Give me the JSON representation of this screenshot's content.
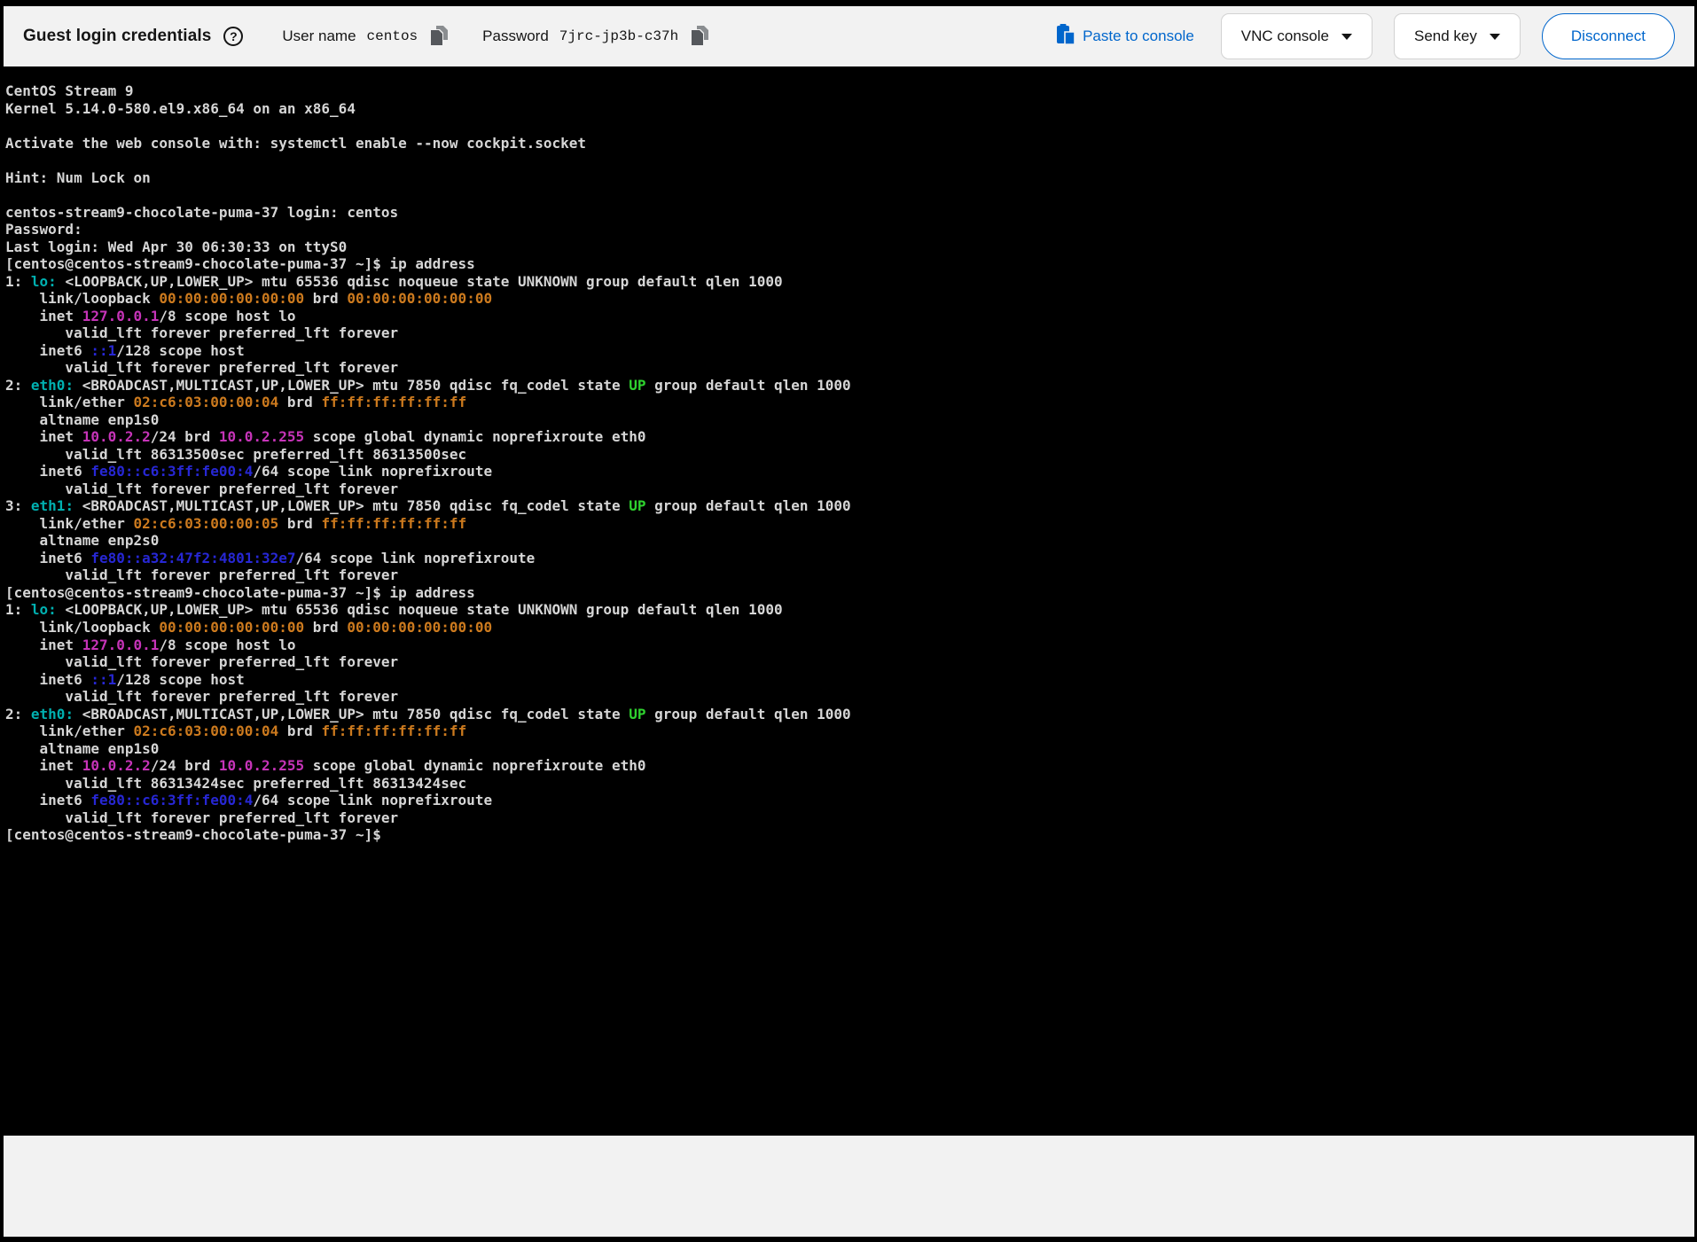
{
  "header": {
    "title": "Guest login credentials",
    "username_label": "User name",
    "username_value": "centos",
    "password_label": "Password",
    "password_value": "7jrc-jp3b-c37h",
    "paste_button_label": "Paste to console",
    "vnc_console_dropdown_label": "VNC console",
    "send_key_dropdown_label": "Send key",
    "disconnect_button_label": "Disconnect",
    "help_icon": "question-circle-icon",
    "copy_icon": "copy-icon",
    "paste_icon": "paste-icon",
    "accent_color": "#0066cc",
    "background_color": "#f2f2f2",
    "text_color": "#151515"
  },
  "terminal": {
    "background_color": "#000000",
    "palette": {
      "default": "#d6d6d6",
      "cyan": "#00b0b0",
      "orange": "#cc7a1e",
      "magenta": "#c634b8",
      "blue": "#2727d4",
      "green": "#2fd22f"
    },
    "lines": [
      [
        {
          "t": "CentOS Stream 9"
        }
      ],
      [
        {
          "t": "Kernel 5.14.0-580.el9.x86_64 on an x86_64"
        }
      ],
      [],
      [
        {
          "t": "Activate the web console with: systemctl enable --now cockpit.socket"
        }
      ],
      [],
      [
        {
          "t": "Hint: Num Lock on"
        }
      ],
      [],
      [
        {
          "t": "centos-stream9-chocolate-puma-37 login: centos"
        }
      ],
      [
        {
          "t": "Password:"
        }
      ],
      [
        {
          "t": "Last login: Wed Apr 30 06:30:33 on ttyS0"
        }
      ],
      [
        {
          "t": "[centos@centos-stream9-chocolate-puma-37 ~]$ ip address"
        }
      ],
      [
        {
          "t": "1: "
        },
        {
          "t": "lo:",
          "c": "cyan"
        },
        {
          "t": " <LOOPBACK,UP,LOWER_UP> mtu 65536 qdisc noqueue state UNKNOWN group default qlen 1000"
        }
      ],
      [
        {
          "t": "    link/loopback "
        },
        {
          "t": "00:00:00:00:00:00",
          "c": "orange"
        },
        {
          "t": " brd "
        },
        {
          "t": "00:00:00:00:00:00",
          "c": "orange"
        }
      ],
      [
        {
          "t": "    inet "
        },
        {
          "t": "127.0.0.1",
          "c": "magenta"
        },
        {
          "t": "/8 scope host lo"
        }
      ],
      [
        {
          "t": "       valid_lft forever preferred_lft forever"
        }
      ],
      [
        {
          "t": "    inet6 "
        },
        {
          "t": "::1",
          "c": "blue"
        },
        {
          "t": "/128 scope host"
        }
      ],
      [
        {
          "t": "       valid_lft forever preferred_lft forever"
        }
      ],
      [
        {
          "t": "2: "
        },
        {
          "t": "eth0:",
          "c": "cyan"
        },
        {
          "t": " <BROADCAST,MULTICAST,UP,LOWER_UP> mtu 7850 qdisc fq_codel state "
        },
        {
          "t": "UP",
          "c": "green"
        },
        {
          "t": " group default qlen 1000"
        }
      ],
      [
        {
          "t": "    link/ether "
        },
        {
          "t": "02:c6:03:00:00:04",
          "c": "orange"
        },
        {
          "t": " brd "
        },
        {
          "t": "ff:ff:ff:ff:ff:ff",
          "c": "orange"
        }
      ],
      [
        {
          "t": "    altname enp1s0"
        }
      ],
      [
        {
          "t": "    inet "
        },
        {
          "t": "10.0.2.2",
          "c": "magenta"
        },
        {
          "t": "/24 brd "
        },
        {
          "t": "10.0.2.255",
          "c": "magenta"
        },
        {
          "t": " scope global dynamic noprefixroute eth0"
        }
      ],
      [
        {
          "t": "       valid_lft 86313500sec preferred_lft 86313500sec"
        }
      ],
      [
        {
          "t": "    inet6 "
        },
        {
          "t": "fe80::c6:3ff:fe00:4",
          "c": "blue"
        },
        {
          "t": "/64 scope link noprefixroute"
        }
      ],
      [
        {
          "t": "       valid_lft forever preferred_lft forever"
        }
      ],
      [
        {
          "t": "3: "
        },
        {
          "t": "eth1:",
          "c": "cyan"
        },
        {
          "t": " <BROADCAST,MULTICAST,UP,LOWER_UP> mtu 7850 qdisc fq_codel state "
        },
        {
          "t": "UP",
          "c": "green"
        },
        {
          "t": " group default qlen 1000"
        }
      ],
      [
        {
          "t": "    link/ether "
        },
        {
          "t": "02:c6:03:00:00:05",
          "c": "orange"
        },
        {
          "t": " brd "
        },
        {
          "t": "ff:ff:ff:ff:ff:ff",
          "c": "orange"
        }
      ],
      [
        {
          "t": "    altname enp2s0"
        }
      ],
      [
        {
          "t": "    inet6 "
        },
        {
          "t": "fe80::a32:47f2:4801:32e7",
          "c": "blue"
        },
        {
          "t": "/64 scope link noprefixroute"
        }
      ],
      [
        {
          "t": "       valid_lft forever preferred_lft forever"
        }
      ],
      [
        {
          "t": "[centos@centos-stream9-chocolate-puma-37 ~]$ ip address"
        }
      ],
      [
        {
          "t": "1: "
        },
        {
          "t": "lo:",
          "c": "cyan"
        },
        {
          "t": " <LOOPBACK,UP,LOWER_UP> mtu 65536 qdisc noqueue state UNKNOWN group default qlen 1000"
        }
      ],
      [
        {
          "t": "    link/loopback "
        },
        {
          "t": "00:00:00:00:00:00",
          "c": "orange"
        },
        {
          "t": " brd "
        },
        {
          "t": "00:00:00:00:00:00",
          "c": "orange"
        }
      ],
      [
        {
          "t": "    inet "
        },
        {
          "t": "127.0.0.1",
          "c": "magenta"
        },
        {
          "t": "/8 scope host lo"
        }
      ],
      [
        {
          "t": "       valid_lft forever preferred_lft forever"
        }
      ],
      [
        {
          "t": "    inet6 "
        },
        {
          "t": "::1",
          "c": "blue"
        },
        {
          "t": "/128 scope host"
        }
      ],
      [
        {
          "t": "       valid_lft forever preferred_lft forever"
        }
      ],
      [
        {
          "t": "2: "
        },
        {
          "t": "eth0:",
          "c": "cyan"
        },
        {
          "t": " <BROADCAST,MULTICAST,UP,LOWER_UP> mtu 7850 qdisc fq_codel state "
        },
        {
          "t": "UP",
          "c": "green"
        },
        {
          "t": " group default qlen 1000"
        }
      ],
      [
        {
          "t": "    link/ether "
        },
        {
          "t": "02:c6:03:00:00:04",
          "c": "orange"
        },
        {
          "t": " brd "
        },
        {
          "t": "ff:ff:ff:ff:ff:ff",
          "c": "orange"
        }
      ],
      [
        {
          "t": "    altname enp1s0"
        }
      ],
      [
        {
          "t": "    inet "
        },
        {
          "t": "10.0.2.2",
          "c": "magenta"
        },
        {
          "t": "/24 brd "
        },
        {
          "t": "10.0.2.255",
          "c": "magenta"
        },
        {
          "t": " scope global dynamic noprefixroute eth0"
        }
      ],
      [
        {
          "t": "       valid_lft 86313424sec preferred_lft 86313424sec"
        }
      ],
      [
        {
          "t": "    inet6 "
        },
        {
          "t": "fe80::c6:3ff:fe00:4",
          "c": "blue"
        },
        {
          "t": "/64 scope link noprefixroute"
        }
      ],
      [
        {
          "t": "       valid_lft forever preferred_lft forever"
        }
      ],
      [
        {
          "t": "[centos@centos-stream9-chocolate-puma-37 ~]$ "
        }
      ]
    ]
  }
}
